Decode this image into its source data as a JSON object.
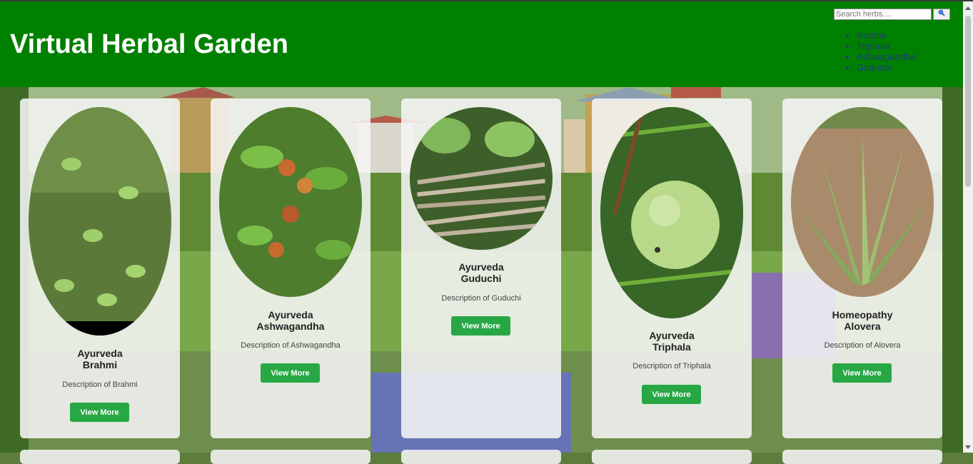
{
  "header": {
    "title": "Virtual Herbal Garden",
    "search_placeholder": "Search herbs....",
    "search_icon": "search-icon",
    "links": [
      "Brahmi",
      "Triphala",
      "Ashwagandha",
      "Guduchi"
    ]
  },
  "colors": {
    "header_bg": "#008000",
    "button": "#28a745"
  },
  "cards": [
    {
      "system": "Ayurveda",
      "name": "Brahmi",
      "description": "Description of Brahmi",
      "button": "View More"
    },
    {
      "system": "Ayurveda",
      "name": "Ashwagandha",
      "description": "Description of Ashwagandha",
      "button": "View More"
    },
    {
      "system": "Ayurveda",
      "name": "Guduchi",
      "description": "Description of Guduchi",
      "button": "View More"
    },
    {
      "system": "Ayurveda",
      "name": "Triphala",
      "description": "Description of Triphala",
      "button": "View More"
    },
    {
      "system": "Homeopathy",
      "name": "Alovera",
      "description": "Description of Alovera",
      "button": "View More"
    }
  ]
}
